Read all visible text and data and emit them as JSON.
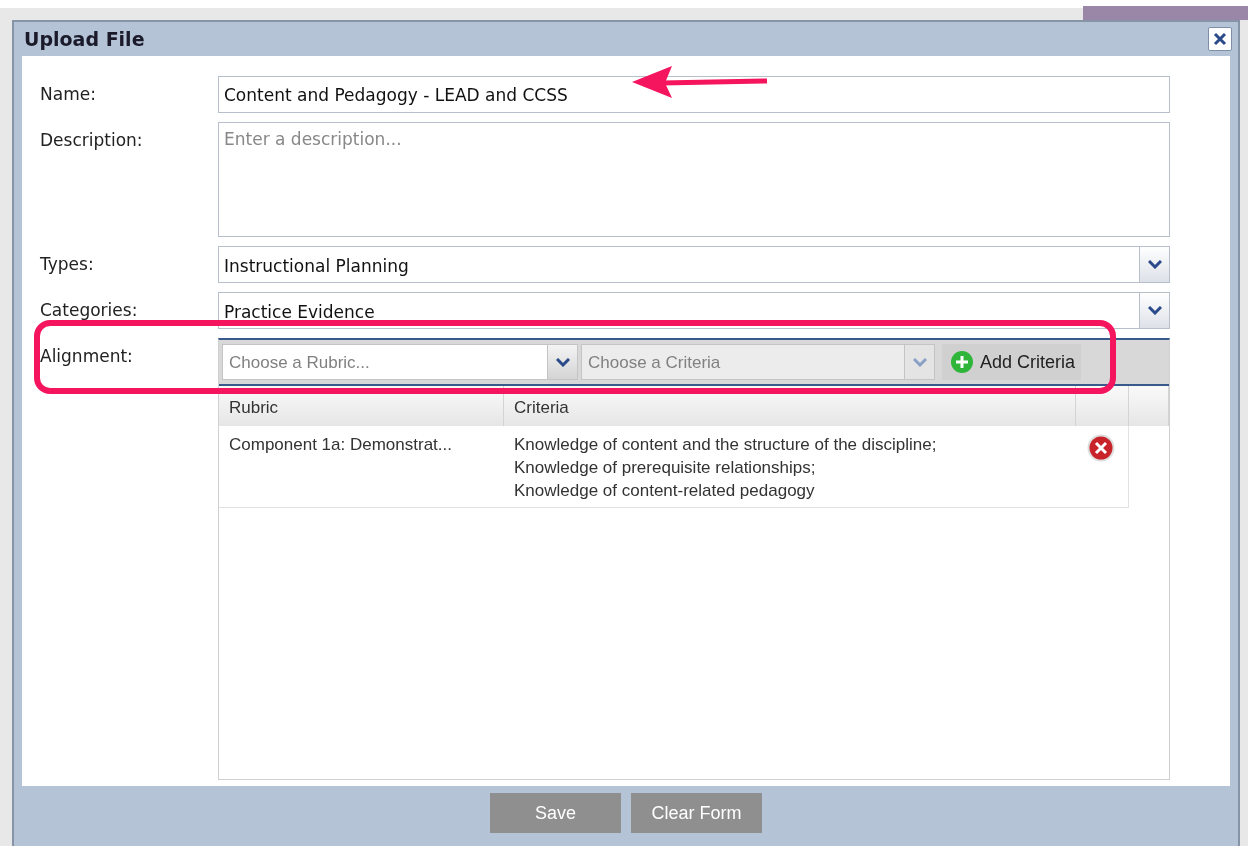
{
  "window": {
    "title": "Upload File"
  },
  "form": {
    "name": {
      "label": "Name:",
      "value": "Content and Pedagogy - LEAD and CCSS"
    },
    "description": {
      "label": "Description:",
      "placeholder": "Enter a description..."
    },
    "types": {
      "label": "Types:",
      "value": "Instructional Planning"
    },
    "categories": {
      "label": "Categories:",
      "value": "Practice Evidence"
    },
    "alignment": {
      "label": "Alignment:",
      "rubric_placeholder": "Choose a Rubric...",
      "criteria_placeholder": "Choose a Criteria",
      "criteria_disabled": true,
      "add_button": "Add Criteria",
      "table": {
        "columns": [
          "Rubric",
          "Criteria"
        ],
        "rows": [
          {
            "rubric": "Component 1a: Demonstrat...",
            "criteria": [
              "Knowledge of content and the structure of the discipline;",
              "Knowledge of prerequisite relationships;",
              "Knowledge of content-related pedagogy"
            ]
          }
        ]
      }
    }
  },
  "buttons": [
    {
      "label": "Save",
      "disabled": true
    },
    {
      "label": "Clear Form",
      "disabled": true
    }
  ]
}
